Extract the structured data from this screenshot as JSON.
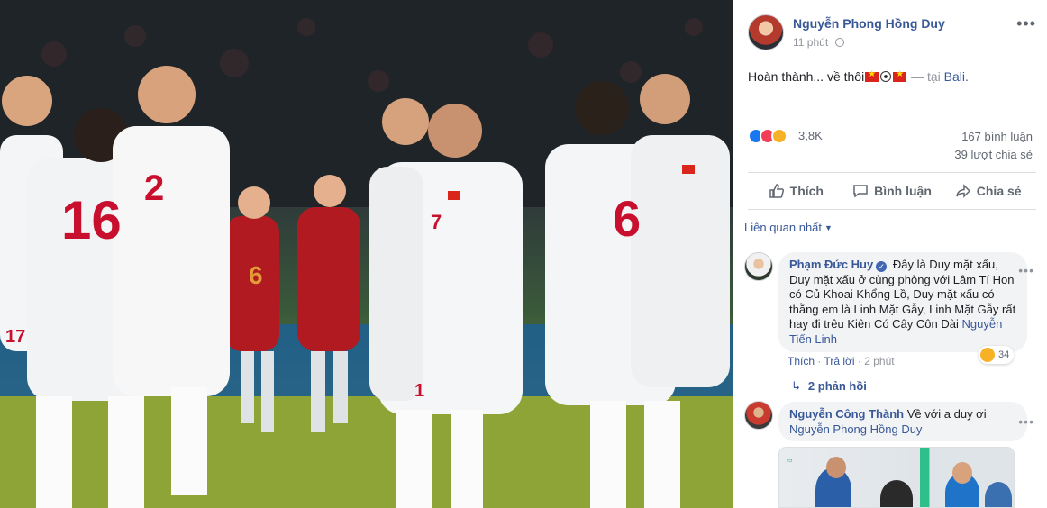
{
  "post": {
    "author": "Nguyễn Phong Hồng Duy",
    "time": "11 phút",
    "caption_text": "Hoàn thành... về thôi",
    "caption_sep": "— tại",
    "caption_place": "Bali.",
    "reaction_count": "3,8K",
    "comments": "167 bình luận",
    "shares": "39 lượt chia sẻ",
    "actions": {
      "like": "Thích",
      "comment": "Bình luận",
      "share": "Chia sẻ"
    },
    "sort": "Liên quan nhất"
  },
  "comments": [
    {
      "name": "Phạm Đức Huy",
      "text": "Đây là Duy mặt xấu, Duy mặt xấu ở cùng phòng với Lâm Tí Hon có Củ Khoai Khổng Lồ, Duy mặt xấu có thằng em là Linh Mặt Gẫy, Linh Mặt Gẫy rất hay đi trêu Kiên Có Cây Côn Dài",
      "tag": "Nguyễn Tiến Linh",
      "reaction_count": "34",
      "like": "Thích",
      "reply": "Trả lời",
      "time": "2 phút",
      "replies": "2 phản hồi"
    },
    {
      "name": "Nguyễn Công Thành",
      "text": "Về với a duy ơi",
      "tag": "Nguyễn Phong Hồng Duy"
    }
  ],
  "photo": {
    "jersey_numbers": [
      "16",
      "2",
      "7",
      "6",
      "6",
      "17",
      "1"
    ]
  },
  "colors": {
    "link": "#385898",
    "meta": "#90949c",
    "like_blue": "#1877f2",
    "kit_red": "#c8102e"
  }
}
